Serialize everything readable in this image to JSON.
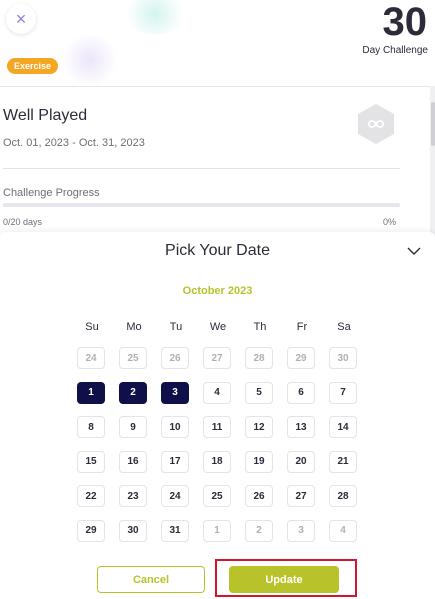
{
  "header": {
    "close_symbol": "×",
    "category_tag": "Exercise",
    "days_number": "30",
    "days_label": "Day Challenge"
  },
  "challenge": {
    "title": "Well Played",
    "dates": "Oct. 01, 2023 - Oct. 31, 2023",
    "badge_icon": "infinity-hexagon-icon",
    "progress_label": "Challenge Progress",
    "progress_days": "0/20 days",
    "progress_percent": "0%",
    "progress_fraction": 0
  },
  "date_picker": {
    "title": "Pick Your Date",
    "collapse_icon": "chevron-down-icon",
    "month": "October 2023",
    "weekdays": [
      "Su",
      "Mo",
      "Tu",
      "We",
      "Th",
      "Fr",
      "Sa"
    ],
    "weeks": [
      [
        "24",
        "25",
        "26",
        "27",
        "28",
        "29",
        "30"
      ],
      [
        "1",
        "2",
        "3",
        "4",
        "5",
        "6",
        "7"
      ],
      [
        "8",
        "9",
        "10",
        "11",
        "12",
        "13",
        "14"
      ],
      [
        "15",
        "16",
        "17",
        "18",
        "19",
        "20",
        "21"
      ],
      [
        "22",
        "23",
        "24",
        "25",
        "26",
        "27",
        "28"
      ],
      [
        "29",
        "30",
        "31",
        "1",
        "2",
        "3",
        "4"
      ]
    ],
    "muted_days": [
      [
        0,
        0
      ],
      [
        0,
        1
      ],
      [
        0,
        2
      ],
      [
        0,
        3
      ],
      [
        0,
        4
      ],
      [
        0,
        5
      ],
      [
        0,
        6
      ],
      [
        5,
        3
      ],
      [
        5,
        4
      ],
      [
        5,
        5
      ],
      [
        5,
        6
      ]
    ],
    "selected_days": [
      [
        1,
        0
      ],
      [
        1,
        1
      ],
      [
        1,
        2
      ]
    ],
    "cancel_label": "Cancel",
    "update_label": "Update"
  },
  "colors": {
    "accent": "#b8c22a",
    "selected": "#0f0f4a",
    "tag": "#f5a623",
    "highlight": "#d0162d"
  }
}
